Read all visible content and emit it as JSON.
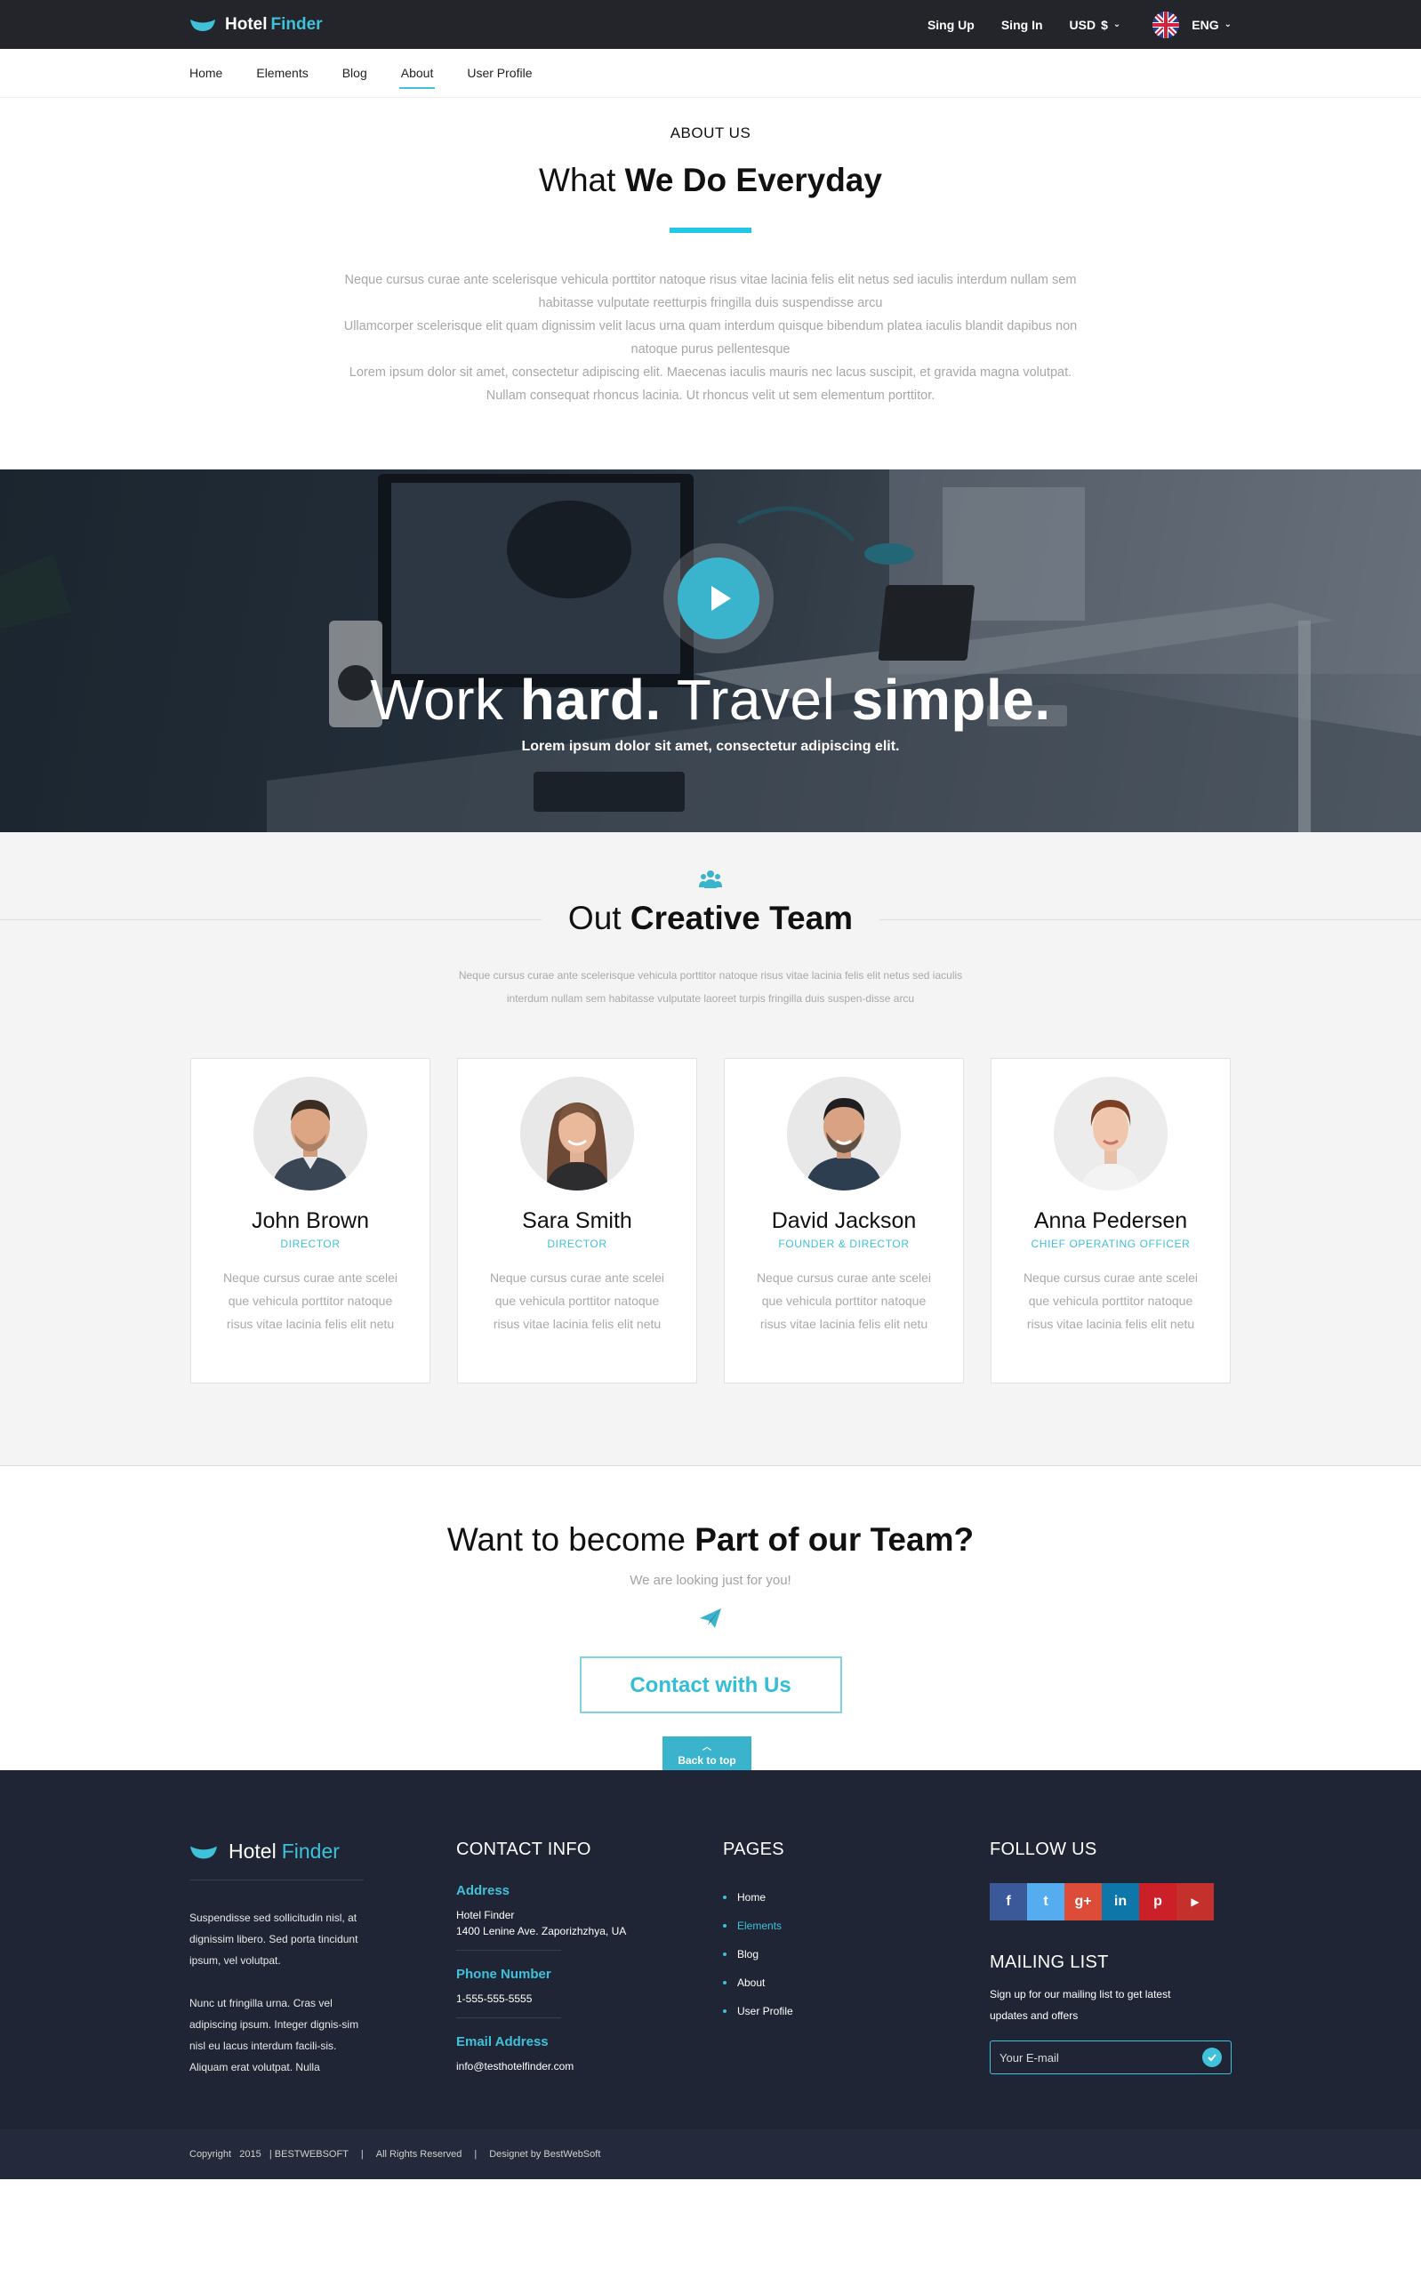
{
  "topbar": {
    "brand_first": "Hotel",
    "brand_second": "Finder",
    "sign_up": "Sing Up",
    "sign_in": "Sing In",
    "currency": "USD",
    "currency_symbol": "$",
    "language": "ENG"
  },
  "nav": {
    "items": [
      "Home",
      "Elements",
      "Blog",
      "About",
      "User Profile"
    ],
    "active": "About"
  },
  "about": {
    "eyebrow": "ABOUT US",
    "title_light": "What",
    "title_bold": "We Do Everyday",
    "paragraph_1": "Neque cursus curae ante scelerisque vehicula porttitor natoque risus vitae lacinia felis elit netus sed iaculis interdum nullam sem habitasse vulputate reetturpis fringilla duis suspendisse arcu",
    "paragraph_2": "Ullamcorper scelerisque elit quam dignissim velit lacus urna quam interdum quisque bibendum platea iaculis blandit dapibus non natoque purus pellentesque",
    "paragraph_3": "Lorem ipsum dolor sit amet, consectetur adipiscing elit. Maecenas iaculis mauris nec lacus suscipit, et gravida magna volutpat. Nullam consequat rhoncus lacinia. Ut rhoncus velit ut sem elementum porttitor."
  },
  "hero": {
    "title_1": "Work",
    "title_2": "hard.",
    "title_3": "Travel",
    "title_4": "simple.",
    "subtitle": "Lorem ipsum dolor sit amet, consectetur adipiscing elit."
  },
  "team": {
    "title_light": "Out",
    "title_bold": "Creative Team",
    "description": "Neque cursus curae ante scelerisque vehicula porttitor natoque risus vitae lacinia felis elit netus sed iaculis interdum nullam sem habitasse vulputate laoreet turpis fringilla duis suspen-disse arcu",
    "members": [
      {
        "name": "John  Brown",
        "role": "DIRECTOR",
        "bio": "Neque cursus curae ante scelei que vehicula porttitor natoque risus vitae lacinia felis elit netu"
      },
      {
        "name": "Sara Smith",
        "role": "DIRECTOR",
        "bio": "Neque cursus curae ante scelei que vehicula porttitor natoque risus vitae lacinia felis elit netu"
      },
      {
        "name": "David Jackson",
        "role": "FOUNDER & DIRECTOR",
        "bio": "Neque cursus curae ante scelei que vehicula porttitor natoque risus vitae lacinia felis elit netu"
      },
      {
        "name": "Anna Pedersen",
        "role": "CHIEF OPERATING OFFICER",
        "bio": "Neque cursus curae ante scelei que vehicula porttitor natoque risus vitae lacinia felis elit netu"
      }
    ]
  },
  "join": {
    "title_light": "Want to become",
    "title_bold": "Part of our Team?",
    "subtitle": "We are looking just for you!",
    "button": "Contact with Us",
    "back_to_top": "Back to top"
  },
  "footer": {
    "brand_first": "Hotel",
    "brand_second": "Finder",
    "text_1": "Suspendisse sed sollicitudin nisl, at dignissim libero. Sed porta tincidunt ipsum, vel volutpat.",
    "text_2": "Nunc ut fringilla urna. Cras vel adipiscing ipsum. Integer dignis-sim nisl eu lacus interdum facili-sis. Aliquam erat volutpat. Nulla",
    "contact_title": "CONTACT INFO",
    "address_label": "Address",
    "address_line_1": "Hotel Finder",
    "address_line_2": "1400 Lenine Ave. Zaporizhzhya, UA",
    "phone_label": "Phone Number",
    "phone": "1-555-555-5555",
    "email_label": "Email Address",
    "email": "info@testhotelfinder.com",
    "pages_title": "PAGES",
    "pages": [
      "Home",
      "Elements",
      "Blog",
      "About",
      "User Profile"
    ],
    "pages_active": "Elements",
    "follow_title": "FOLLOW US",
    "socials": [
      {
        "icon": "facebook-icon",
        "glyph": "f",
        "color": "#3b5998"
      },
      {
        "icon": "twitter-icon",
        "glyph": "t",
        "color": "#55acee"
      },
      {
        "icon": "google-plus-icon",
        "glyph": "g+",
        "color": "#dd4b39"
      },
      {
        "icon": "linkedin-icon",
        "glyph": "in",
        "color": "#0e76a8"
      },
      {
        "icon": "pinterest-icon",
        "glyph": "p",
        "color": "#cb2027"
      },
      {
        "icon": "youtube-icon",
        "glyph": "▶",
        "color": "#c4302b"
      }
    ],
    "mailing_title": "MAILING LIST",
    "mailing_text": "Sign up for our mailing list to get latest updates and offers",
    "mailing_placeholder": "Your E-mail"
  },
  "bottombar": {
    "copyright": "Copyright   2015   | BESTWEBSOFT",
    "rights": "All Rights Reserved",
    "designer": "Designet by BestWebSoft"
  },
  "colors": {
    "accent": "#3ec1d9",
    "topbar_bg": "#23252b",
    "footer_bg": "#202535"
  }
}
